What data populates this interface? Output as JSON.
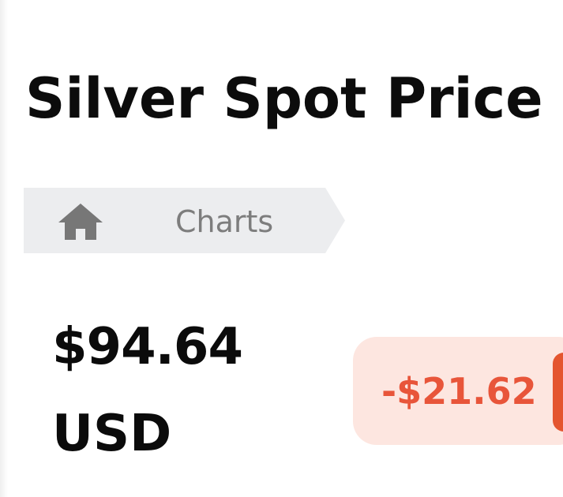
{
  "header": {
    "title": "Silver Spot Price"
  },
  "breadcrumb": {
    "home_icon": "home-icon",
    "current_label": "Charts"
  },
  "price": {
    "value": "$94.64",
    "currency": "USD"
  },
  "change": {
    "amount": "-$21.62"
  },
  "colors": {
    "breadcrumb_bg": "#ecedef",
    "breadcrumb_text": "#7d7d7d",
    "negative_text": "#e8553a",
    "negative_bg": "#fde6e0",
    "negative_accent": "#e4552f"
  }
}
